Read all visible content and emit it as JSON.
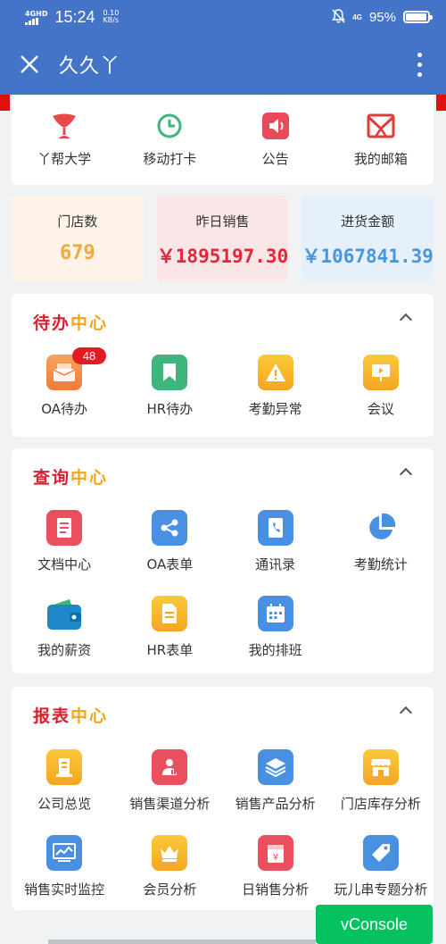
{
  "status_bar": {
    "network": "4GHD",
    "time": "15:24",
    "speed_value": "0.10",
    "speed_unit": "KB/s",
    "lte": "4G",
    "battery": "95%",
    "battery_level": 0.95
  },
  "header": {
    "title": "久久丫",
    "color": "#4374c8"
  },
  "quick_links": [
    {
      "label": "丫帮大学",
      "icon": "cup-icon"
    },
    {
      "label": "移动打卡",
      "icon": "clock-icon"
    },
    {
      "label": "公告",
      "icon": "megaphone-icon"
    },
    {
      "label": "我的邮箱",
      "icon": "mail-icon"
    }
  ],
  "stats": [
    {
      "label": "门店数",
      "value": "679"
    },
    {
      "label": "昨日销售",
      "value": "￥1895197.30"
    },
    {
      "label": "进货金额",
      "value": "￥1067841.39"
    }
  ],
  "todo": {
    "title_a": "待办",
    "title_b": "中心",
    "items": [
      {
        "label": "OA待办",
        "icon": "envelope-icon",
        "badge": "48"
      },
      {
        "label": "HR待办",
        "icon": "bookmark-icon"
      },
      {
        "label": "考勤异常",
        "icon": "warning-icon"
      },
      {
        "label": "会议",
        "icon": "meeting-icon"
      }
    ]
  },
  "query": {
    "title_a": "查询",
    "title_b": "中心",
    "items": [
      {
        "label": "文档中心",
        "icon": "document-icon"
      },
      {
        "label": "OA表单",
        "icon": "share-icon"
      },
      {
        "label": "通讯录",
        "icon": "contacts-icon"
      },
      {
        "label": "考勤统计",
        "icon": "pie-chart-icon"
      },
      {
        "label": "我的薪资",
        "icon": "wallet-icon"
      },
      {
        "label": "HR表单",
        "icon": "form-icon"
      },
      {
        "label": "我的排班",
        "icon": "calendar-icon"
      }
    ]
  },
  "report": {
    "title_a": "报表",
    "title_b": "中心",
    "items": [
      {
        "label": "公司总览",
        "icon": "building-icon"
      },
      {
        "label": "销售渠道分析",
        "icon": "channel-chart-icon"
      },
      {
        "label": "销售产品分析",
        "icon": "layers-icon"
      },
      {
        "label": "门店库存分析",
        "icon": "store-icon"
      },
      {
        "label": "销售实时监控",
        "icon": "monitor-icon"
      },
      {
        "label": "会员分析",
        "icon": "crown-icon"
      },
      {
        "label": "日销售分析",
        "icon": "yen-calendar-icon"
      },
      {
        "label": "玩儿串专题分析",
        "icon": "tag-icon"
      }
    ]
  },
  "vconsole_label": "vConsole"
}
